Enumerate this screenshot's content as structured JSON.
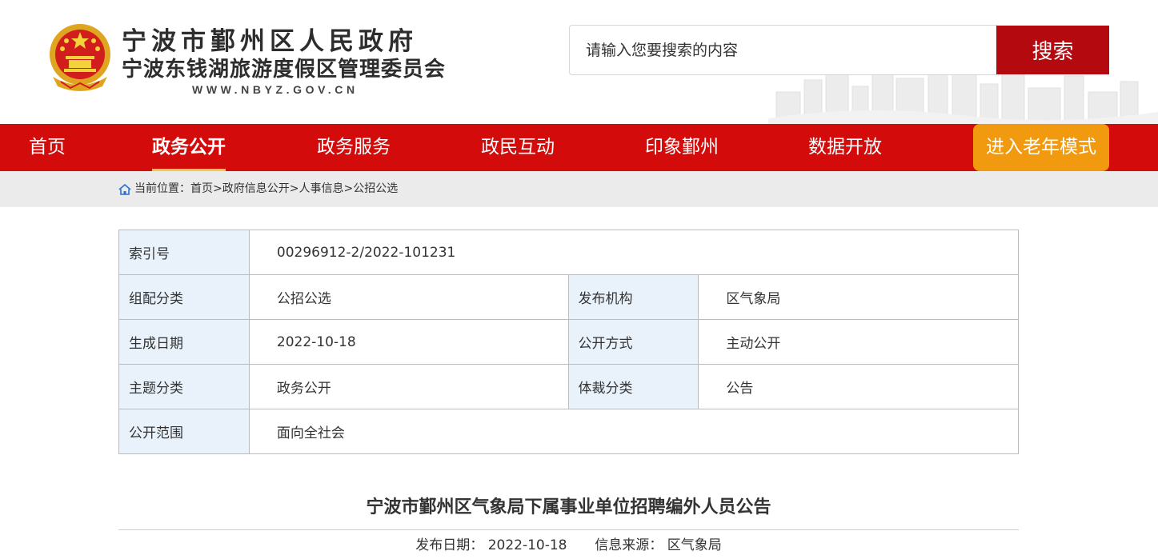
{
  "header": {
    "title_line1": "宁波市鄞州区人民政府",
    "title_line2": "宁波东钱湖旅游度假区管理委员会",
    "url": "WWW.NBYZ.GOV.CN",
    "search_placeholder": "请输入您要搜索的内容",
    "search_button": "搜索"
  },
  "nav": {
    "items": [
      {
        "label": "首页"
      },
      {
        "label": "政务公开"
      },
      {
        "label": "政务服务"
      },
      {
        "label": "政民互动"
      },
      {
        "label": "印象鄞州"
      },
      {
        "label": "数据开放"
      }
    ],
    "active_index": 1,
    "elder_mode": "进入老年模式"
  },
  "breadcrumb": {
    "prefix": "当前位置：",
    "path": "首页>政府信息公开>人事信息>公招公选"
  },
  "info": {
    "index_label": "索引号",
    "index_value": "00296912-2/2022-101231",
    "category_label": "组配分类",
    "category_value": "公招公选",
    "publisher_label": "发布机构",
    "publisher_value": "区气象局",
    "date_label": "生成日期",
    "date_value": "2022-10-18",
    "method_label": "公开方式",
    "method_value": "主动公开",
    "topic_label": "主题分类",
    "topic_value": "政务公开",
    "genre_label": "体裁分类",
    "genre_value": "公告",
    "scope_label": "公开范围",
    "scope_value": "面向全社会"
  },
  "article": {
    "title": "宁波市鄞州区气象局下属事业单位招聘编外人员公告",
    "date_label": "发布日期：",
    "date_value": "2022-10-18",
    "source_label": "信息来源：",
    "source_value": "区气象局"
  },
  "colors": {
    "nav_red": "#d30b0b",
    "search_red": "#b4090e",
    "elder_orange": "#f19a10",
    "label_bg": "#e9f2fb"
  }
}
